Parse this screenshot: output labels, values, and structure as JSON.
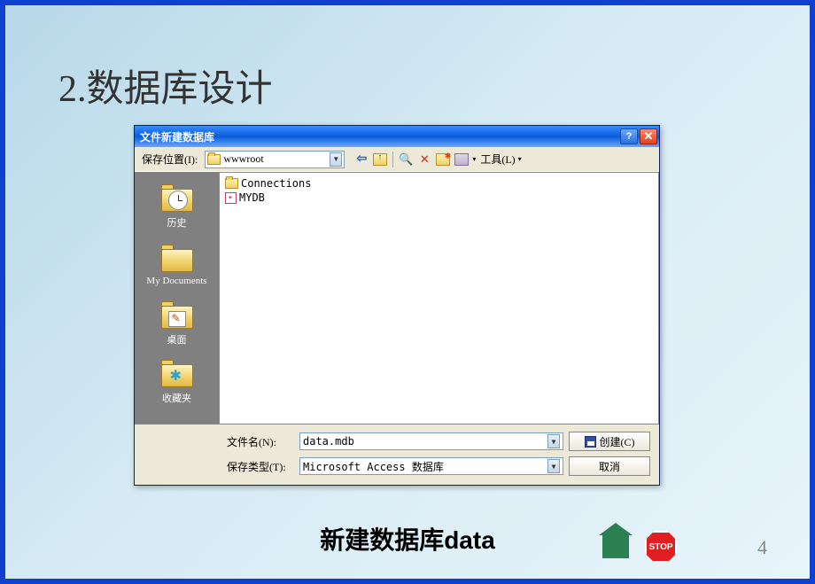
{
  "slide": {
    "title": "2.数据库设计",
    "caption": "新建数据库data",
    "page_number": "4",
    "stop_label": "STOP"
  },
  "dialog": {
    "title": "文件新建数据库",
    "save_location_label": "保存位置(I):",
    "save_location_value": "wwwroot",
    "tools_label": "工具(L)",
    "files": [
      {
        "name": "Connections",
        "type": "folder"
      },
      {
        "name": "MYDB",
        "type": "db"
      }
    ],
    "places": [
      {
        "label": "历史"
      },
      {
        "label": "My Documents"
      },
      {
        "label": "桌面"
      },
      {
        "label": "收藏夹"
      }
    ],
    "filename_label": "文件名(N):",
    "filename_value": "data.mdb",
    "filetype_label": "保存类型(T):",
    "filetype_value": "Microsoft Access 数据库",
    "create_button": "创建(C)",
    "cancel_button": "取消"
  }
}
